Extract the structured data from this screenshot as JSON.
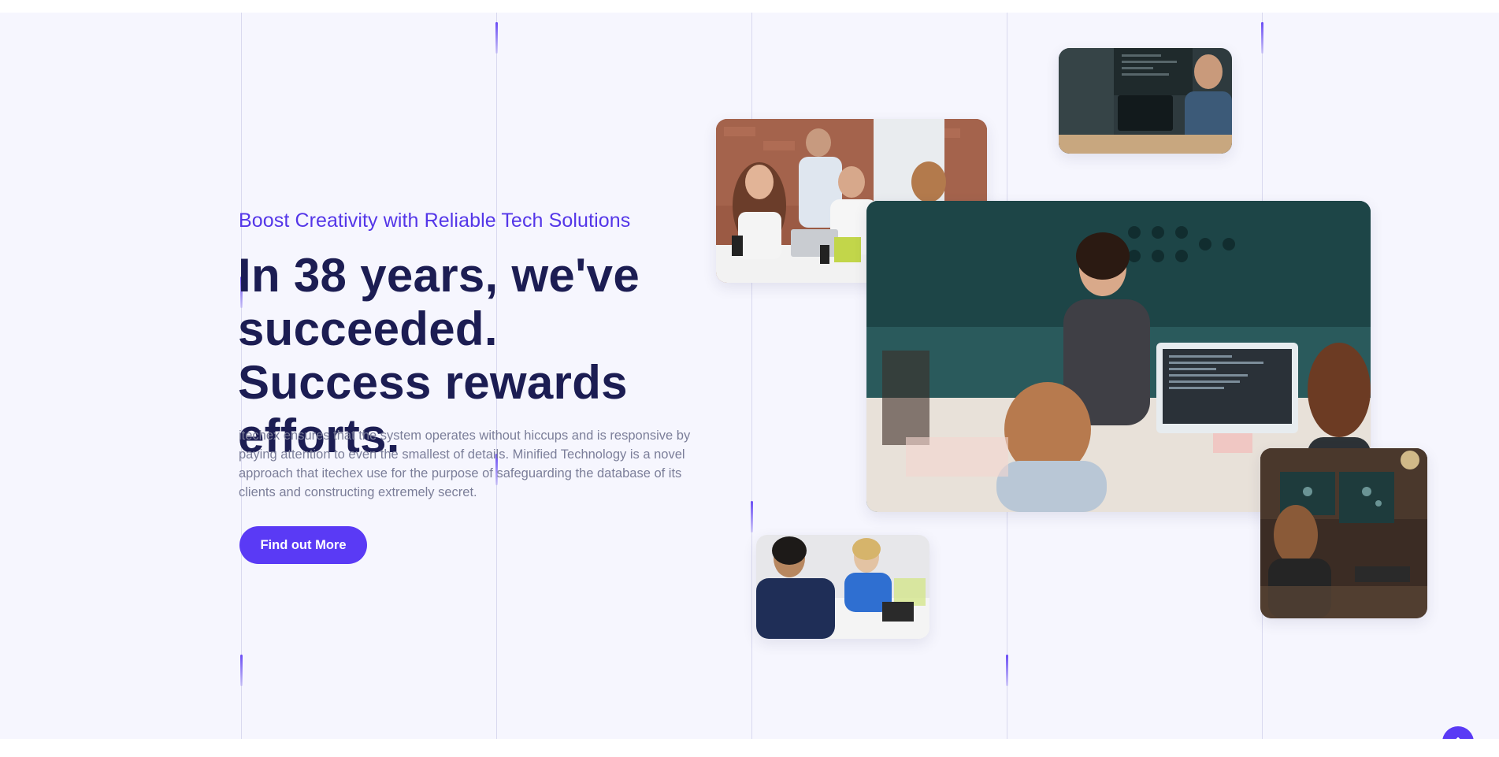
{
  "hero": {
    "eyebrow": "Boost Creativity with Reliable Tech Solutions",
    "headline": "In 38 years, we've succeeded. Success rewards efforts.",
    "body": "itechex ensures that the system operates without hiccups and is responsive by paying attention to even the smallest of details. Minified Technology is a novel approach that itechex use for the purpose of safeguarding the database of its clients and constructing extremely secret.",
    "cta_label": "Find out More"
  },
  "images": [
    {
      "name": "team-meeting-photo",
      "alt": "team working at laptops"
    },
    {
      "name": "developer-photo",
      "alt": "developer coding at monitor"
    },
    {
      "name": "office-discussion-photo",
      "alt": "colleagues in open office"
    },
    {
      "name": "interview-photo",
      "alt": "two people at a desk"
    },
    {
      "name": "night-coding-photo",
      "alt": "people coding in dim room"
    }
  ],
  "icons": {
    "scroll_top": "double-chevron-up-icon"
  },
  "colors": {
    "accent": "#5a3af5",
    "heading": "#1c1d53",
    "body": "#7b7e99",
    "background": "#f6f6fe"
  }
}
